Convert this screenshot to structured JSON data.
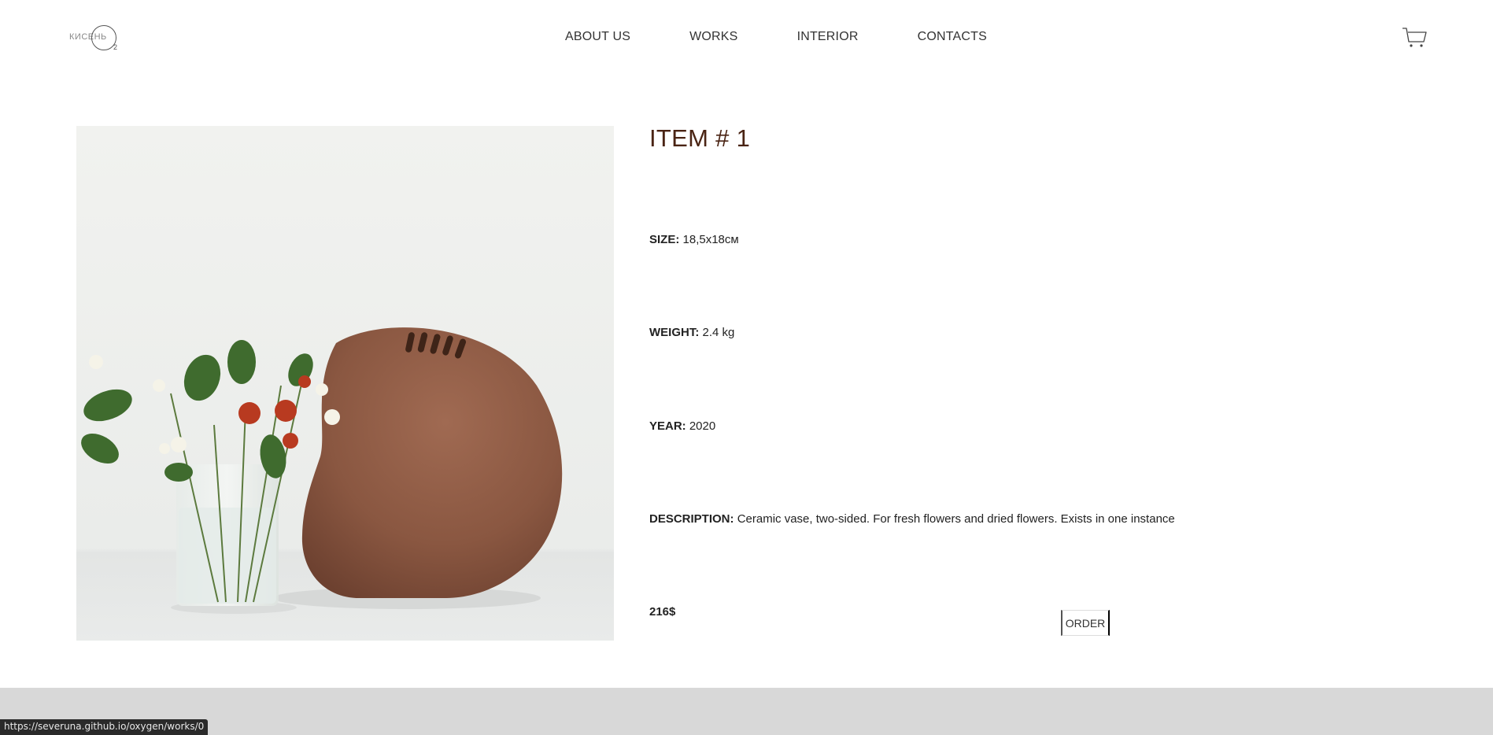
{
  "header": {
    "logo_text": "КИСЕНЬ",
    "logo_sub": "2",
    "nav": [
      {
        "label": "ABOUT US"
      },
      {
        "label": "WORKS"
      },
      {
        "label": "INTERIOR"
      },
      {
        "label": "CONTACTS"
      }
    ],
    "cart_icon": "cart-icon"
  },
  "product": {
    "title": "ITEM # 1",
    "size_label": "SIZE:",
    "size_value": "18,5x18см",
    "weight_label": "WEIGHT:",
    "weight_value": "2.4 kg",
    "year_label": "YEAR:",
    "year_value": "2020",
    "description_label": "DESCRIPTION:",
    "description_value": "Ceramic vase, two-sided. For fresh flowers and dried flowers. Exists in one instance",
    "price": "216$",
    "order_label": "ORDER"
  },
  "status_bar": {
    "url": "https://severuna.github.io/oxygen/works/0"
  },
  "colors": {
    "title": "#4a2414",
    "vase": "#8a5741",
    "footer": "#d8d8d8"
  }
}
